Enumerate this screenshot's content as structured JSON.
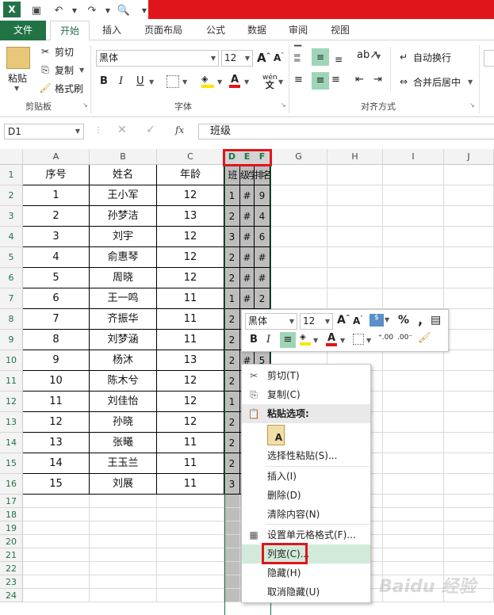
{
  "app": {
    "accent": "#217346",
    "highlight": "#e0151b"
  },
  "tabs": [
    "文件",
    "开始",
    "插入",
    "页面布局",
    "公式",
    "数据",
    "审阅",
    "视图"
  ],
  "clipboard": {
    "paste": "粘贴",
    "cut": "剪切",
    "copy": "复制",
    "painter": "格式刷",
    "label": "剪贴板"
  },
  "font": {
    "name": "黑体",
    "size": "12",
    "bold": "B",
    "italic": "I",
    "underline": "U",
    "phonetic": "wén",
    "label": "字体"
  },
  "align": {
    "wrap": "自动换行",
    "merge": "合并后居中",
    "label": "对齐方式"
  },
  "formula": {
    "cell": "D1",
    "fx": "fx",
    "value": "班级"
  },
  "columns": [
    "A",
    "B",
    "C",
    "D",
    "E",
    "F",
    "G",
    "H",
    "I",
    "J"
  ],
  "headers": [
    "序号",
    "姓名",
    "年龄",
    "班级",
    "学号",
    "排名"
  ],
  "headers_shown": {
    "d": "班",
    "e": "级学",
    "f": "排名"
  },
  "rows": [
    [
      "1",
      "王小军",
      "12",
      "1",
      "#",
      "9"
    ],
    [
      "2",
      "孙梦洁",
      "13",
      "2",
      "#",
      "4"
    ],
    [
      "3",
      "刘宇",
      "12",
      "3",
      "#",
      "6"
    ],
    [
      "4",
      "俞惠琴",
      "12",
      "2",
      "#",
      "#"
    ],
    [
      "5",
      "周晓",
      "12",
      "2",
      "#",
      "#"
    ],
    [
      "6",
      "王一鸣",
      "11",
      "1",
      "#",
      "2"
    ],
    [
      "7",
      "齐振华",
      "11",
      "2",
      "",
      ""
    ],
    [
      "8",
      "刘梦涵",
      "11",
      "2",
      "",
      ""
    ],
    [
      "9",
      "杨沐",
      "13",
      "2",
      "#",
      "5"
    ],
    [
      "10",
      "陈木兮",
      "12",
      "2",
      "",
      ""
    ],
    [
      "11",
      "刘佳怡",
      "12",
      "1",
      "",
      ""
    ],
    [
      "12",
      "孙晓",
      "12",
      "2",
      "",
      ""
    ],
    [
      "13",
      "张曦",
      "11",
      "2",
      "",
      ""
    ],
    [
      "14",
      "王玉兰",
      "11",
      "2",
      "",
      ""
    ],
    [
      "15",
      "刘展",
      "11",
      "3",
      "",
      ""
    ]
  ],
  "row_numbers": [
    "1",
    "2",
    "3",
    "4",
    "5",
    "6",
    "7",
    "8",
    "9",
    "10",
    "11",
    "12",
    "13",
    "14",
    "15",
    "16",
    "17",
    "18",
    "19",
    "20",
    "21",
    "22",
    "23",
    "24"
  ],
  "mini_toolbar": {
    "font": "黑体",
    "size": "12",
    "percent": "%",
    "comma": ",",
    "bold": "B",
    "italic": "I"
  },
  "context_menu": {
    "cut": "剪切(T)",
    "copy": "复制(C)",
    "paste_options": "粘贴选项:",
    "paste_special": "选择性粘贴(S)...",
    "insert": "插入(I)",
    "delete": "删除(D)",
    "clear": "清除内容(N)",
    "format_cells": "设置单元格格式(F)...",
    "col_width": "列宽(C)...",
    "hide": "隐藏(H)",
    "unhide": "取消隐藏(U)"
  },
  "watermark": "Baidu 经验"
}
